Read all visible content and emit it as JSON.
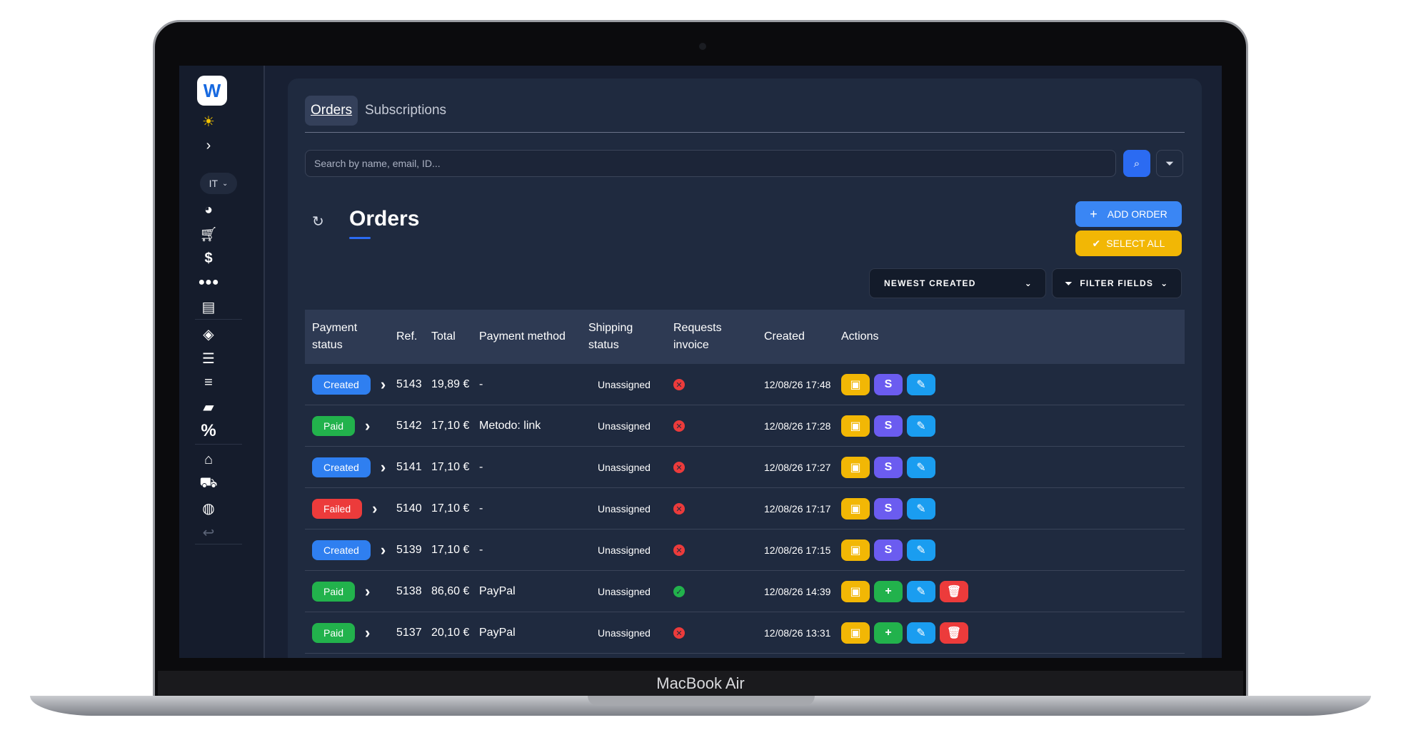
{
  "device": {
    "label": "MacBook Air"
  },
  "sidebar": {
    "logo": "W",
    "lang": "IT",
    "icons": [
      "sun-icon",
      "chevron-right-icon",
      "pie-chart-icon",
      "cart-icon",
      "dollar-icon",
      "users-icon",
      "box-icon",
      "tag-icon",
      "list-ordered-icon",
      "filter-lines-icon",
      "folder-icon",
      "percent-icon",
      "warehouse-icon",
      "truck-icon",
      "globe-icon",
      "return-icon"
    ]
  },
  "tabs": [
    {
      "label": "Orders",
      "active": true
    },
    {
      "label": "Subscriptions",
      "active": false
    }
  ],
  "search": {
    "placeholder": "Search by name, email, ID..."
  },
  "header": {
    "title": "Orders",
    "add_label": "ADD ORDER",
    "select_all_label": "SELECT ALL",
    "sort_label": "NEWEST CREATED",
    "fields_label": "FILTER FIELDS"
  },
  "table": {
    "columns": {
      "payment_status": "Payment status",
      "ref": "Ref.",
      "total": "Total",
      "payment_method": "Payment method",
      "shipping_status": "Shipping status",
      "requests_invoice": "Requests invoice",
      "created": "Created",
      "actions": "Actions"
    },
    "rows": [
      {
        "status": "Created",
        "status_color": "#2f7ff0",
        "ref": "5143",
        "total": "19,89 €",
        "method": "-",
        "shipping": "Unassigned",
        "invoice": "no",
        "created": "12/08/26 17:48",
        "actions": [
          "doc",
          "stripe",
          "edit"
        ]
      },
      {
        "status": "Paid",
        "status_color": "#22b24c",
        "ref": "5142",
        "total": "17,10 €",
        "method": "Metodo: link",
        "shipping": "Unassigned",
        "invoice": "no",
        "created": "12/08/26 17:28",
        "actions": [
          "doc",
          "stripe",
          "edit"
        ]
      },
      {
        "status": "Created",
        "status_color": "#2f7ff0",
        "ref": "5141",
        "total": "17,10 €",
        "method": "-",
        "shipping": "Unassigned",
        "invoice": "no",
        "created": "12/08/26 17:27",
        "actions": [
          "doc",
          "stripe",
          "edit"
        ]
      },
      {
        "status": "Failed",
        "status_color": "#ec3b3b",
        "ref": "5140",
        "total": "17,10 €",
        "method": "-",
        "shipping": "Unassigned",
        "invoice": "no",
        "created": "12/08/26 17:17",
        "actions": [
          "doc",
          "stripe",
          "edit"
        ]
      },
      {
        "status": "Created",
        "status_color": "#2f7ff0",
        "ref": "5139",
        "total": "17,10 €",
        "method": "-",
        "shipping": "Unassigned",
        "invoice": "no",
        "created": "12/08/26 17:15",
        "actions": [
          "doc",
          "stripe",
          "edit"
        ]
      },
      {
        "status": "Paid",
        "status_color": "#22b24c",
        "ref": "5138",
        "total": "86,60 €",
        "method": "PayPal",
        "shipping": "Unassigned",
        "invoice": "yes",
        "created": "12/08/26 14:39",
        "actions": [
          "doc",
          "add",
          "edit",
          "delete"
        ]
      },
      {
        "status": "Paid",
        "status_color": "#22b24c",
        "ref": "5137",
        "total": "20,10 €",
        "method": "PayPal",
        "shipping": "Unassigned",
        "invoice": "no",
        "created": "12/08/26 13:31",
        "actions": [
          "doc",
          "add",
          "edit",
          "delete"
        ]
      }
    ]
  },
  "colors": {
    "accent": "#2b6bf2",
    "doc": "#f2b705",
    "stripe": "#6b5cf0",
    "edit": "#1a9df0",
    "add": "#22b24c",
    "delete": "#ec3b3b",
    "invoice_no": "#ec3b3b",
    "invoice_yes": "#22b24c"
  }
}
